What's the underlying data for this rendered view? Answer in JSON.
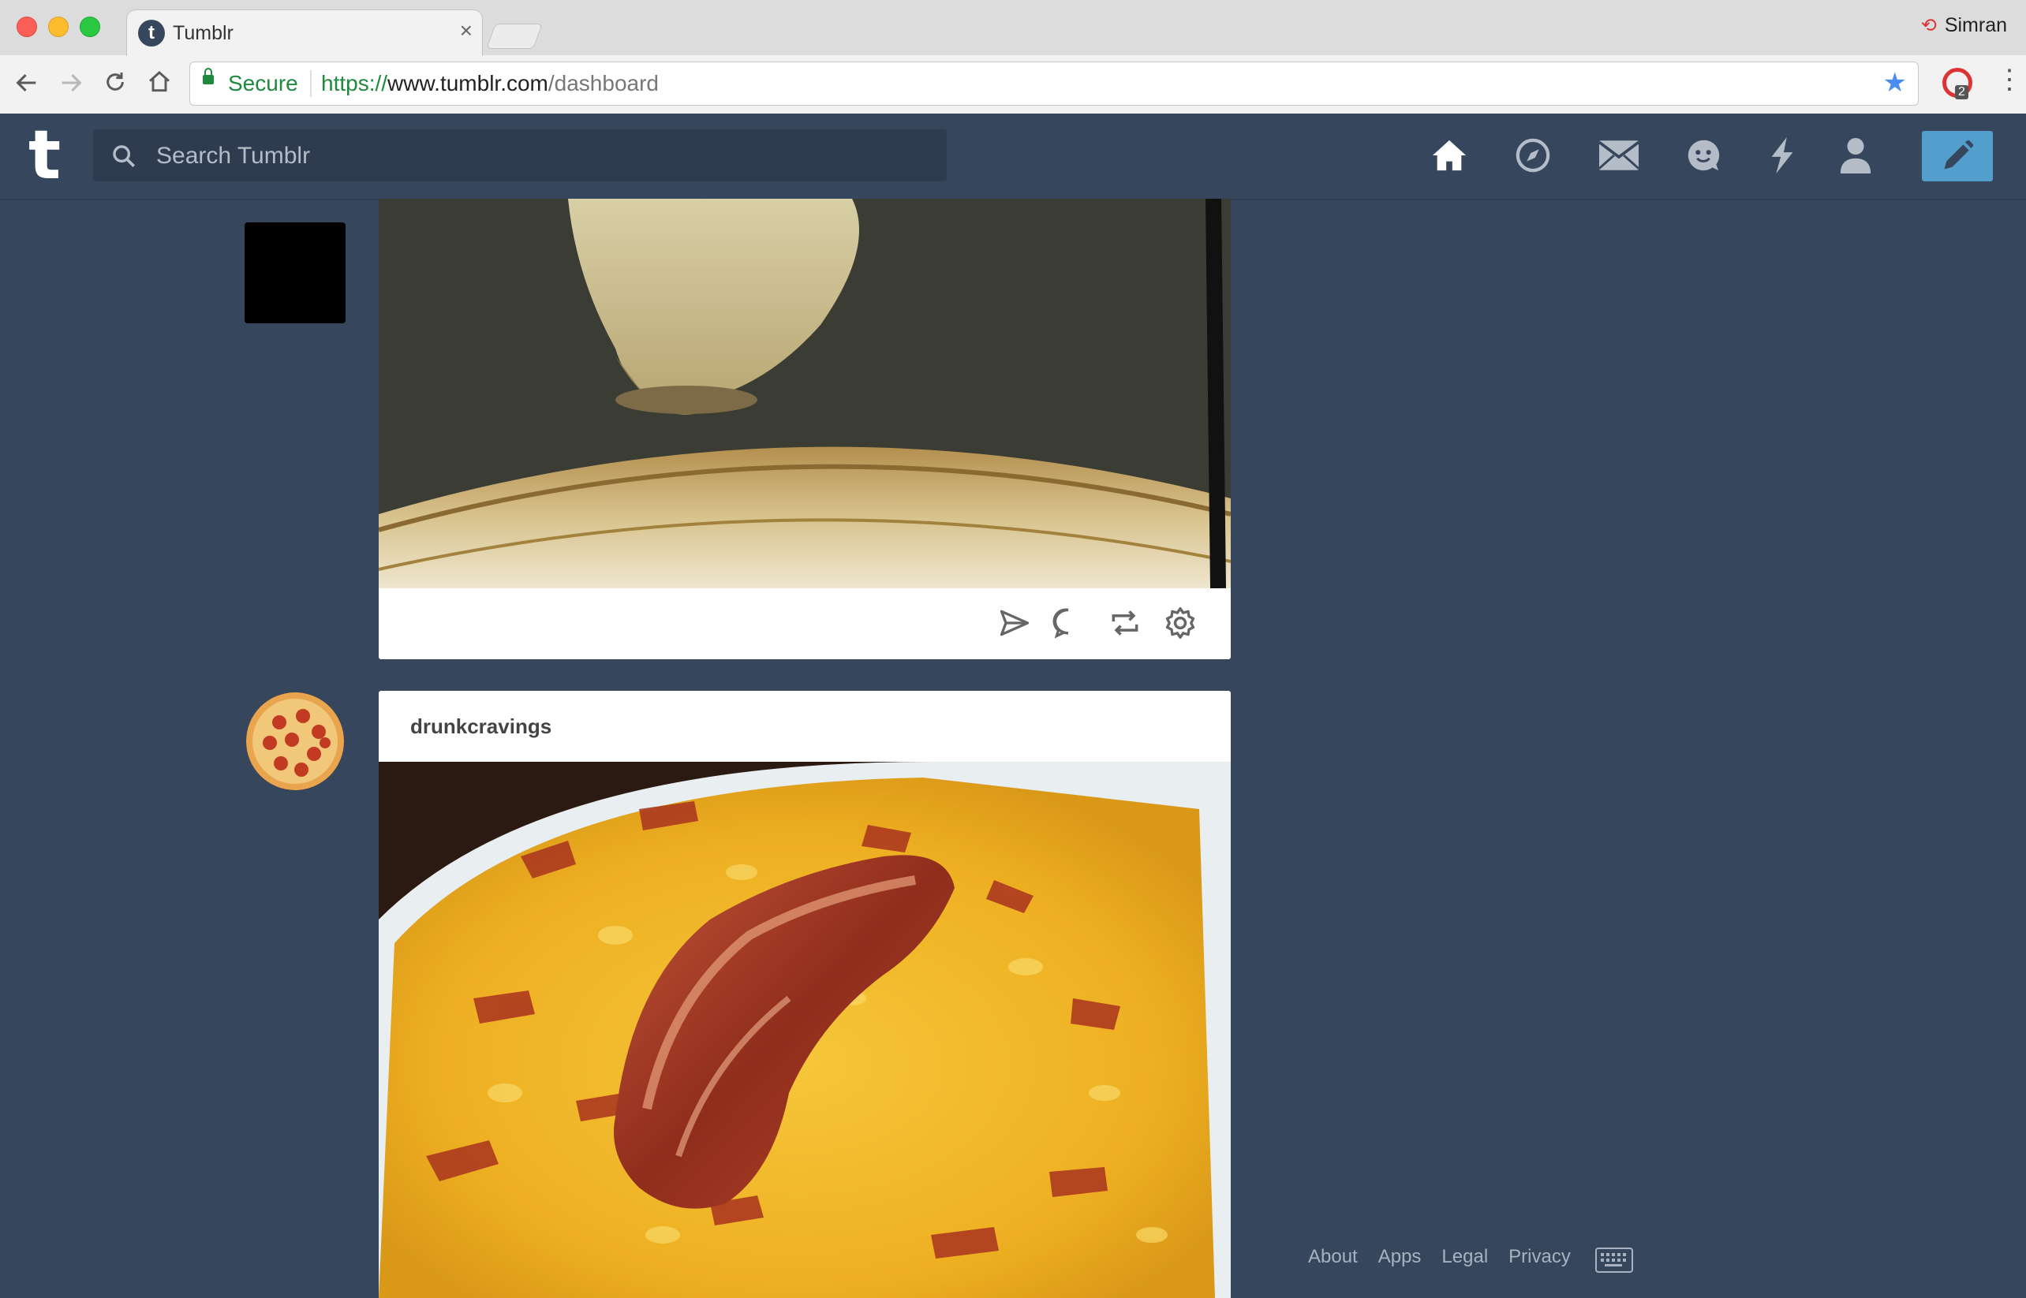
{
  "browser": {
    "tab_title": "Tumblr",
    "tab_favicon": "t",
    "tab_close": "×",
    "profile_name": "Simran",
    "secure_label": "Secure",
    "url_scheme": "https://",
    "url_host": "www.tumblr.com",
    "url_path": "/dashboard",
    "extension_badge": "2",
    "icons": [
      "back-icon",
      "forward-icon",
      "reload-icon",
      "home-icon",
      "lock-icon",
      "star-icon",
      "menu-icon"
    ]
  },
  "tumblr": {
    "logo": "t",
    "search_placeholder": "Search Tumblr",
    "nav_icons": [
      "home-icon",
      "explore-icon",
      "inbox-icon",
      "messaging-icon",
      "activity-icon",
      "account-icon",
      "compose-icon"
    ],
    "accent_color": "#529ecc",
    "background_color": "#36465d"
  },
  "posts": [
    {
      "blog_name": "",
      "actions": [
        "share-icon",
        "reply-icon",
        "reblog-icon",
        "settings-icon"
      ]
    },
    {
      "blog_name": "drunkcravings"
    }
  ],
  "footer": {
    "links": [
      "About",
      "Apps",
      "Legal",
      "Privacy"
    ]
  }
}
